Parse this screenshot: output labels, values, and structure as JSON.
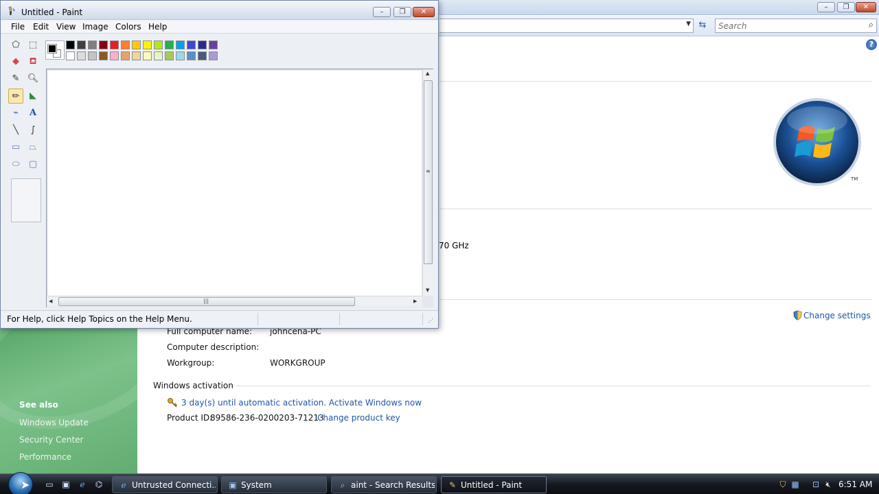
{
  "system": {
    "search_placeholder": "Search",
    "help_glyph": "?",
    "cpu_speed_fragment": "70 GHz",
    "trademark": "TM",
    "change_settings": "Change settings",
    "full_computer_name_label": "Full computer name:",
    "full_computer_name_value": "johncena-PC",
    "computer_description_label": "Computer description:",
    "workgroup_label": "Workgroup:",
    "workgroup_value": "WORKGROUP",
    "activation_heading": "Windows activation",
    "activation_link": "3 day(s) until automatic activation. Activate Windows now",
    "product_id_label": "Product ID:",
    "product_id_value": "89586-236-0200203-71213",
    "change_product_key": "Change product key",
    "see_also": "See also",
    "see_also_links": [
      "Windows Update",
      "Security Center",
      "Performance"
    ]
  },
  "paint": {
    "title": "Untitled - Paint",
    "menu": [
      "File",
      "Edit",
      "View",
      "Image",
      "Colors",
      "Help"
    ],
    "status_text": "For Help, click Help Topics on the Help Menu.",
    "foreground_color": "#000000",
    "background_color": "#ffffff",
    "palette_top": [
      "#000000",
      "#404040",
      "#7f7f7f",
      "#880015",
      "#ed1c24",
      "#ff7f27",
      "#ffc90e",
      "#fff200",
      "#b5e61d",
      "#22b14c",
      "#00a2e8",
      "#3f48cc",
      "#2b2b8c",
      "#6a3fa0"
    ],
    "palette_bottom": [
      "#ffffff",
      "#dcdcdc",
      "#c3c3c3",
      "#8b5a2b",
      "#ffaec9",
      "#e3a46c",
      "#f0d49a",
      "#fff7c0",
      "#e6f5c3",
      "#a8c85a",
      "#99d9ea",
      "#5b8fc7",
      "#4a5a7a",
      "#a99ccf"
    ],
    "selected_tool": "pencil"
  },
  "taskbar": {
    "tasks": [
      {
        "label": "Untrusted Connecti...",
        "icon": "ie-icon"
      },
      {
        "label": "System",
        "icon": "system-icon"
      },
      {
        "label": "aint - Search Results...",
        "icon": "search-results-icon"
      },
      {
        "label": "Untitled - Paint",
        "icon": "paint-icon"
      }
    ],
    "active_task": "Untitled - Paint",
    "clock": "6:51 AM"
  }
}
